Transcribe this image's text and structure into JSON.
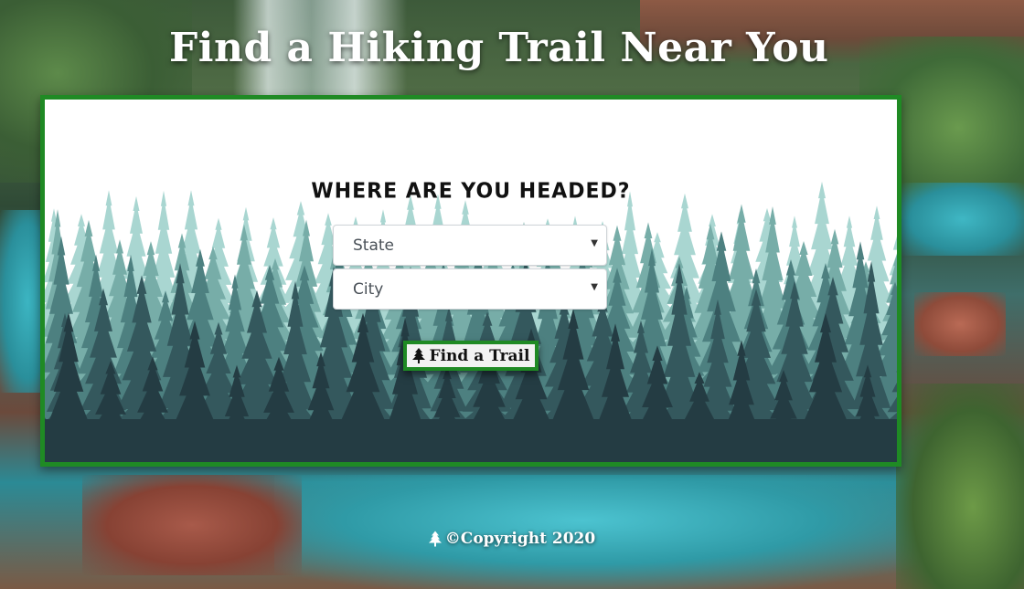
{
  "header": {
    "title": "Find a Hiking Trail Near You",
    "icon": "hiker-icon"
  },
  "search": {
    "question": "Where are you headed?",
    "state_select": {
      "selected": "State",
      "icon": "chevron-down-icon"
    },
    "city_select": {
      "selected": "City",
      "icon": "chevron-down-icon"
    },
    "submit_label": "Find a Trail",
    "submit_icon": "tree-icon"
  },
  "footer": {
    "text": "©Copyright 2020",
    "icon": "tree-icon"
  },
  "colors": {
    "accent_border": "#1f8a24",
    "forest_dark": "#223a40",
    "forest_light": "#9fd1cd"
  }
}
